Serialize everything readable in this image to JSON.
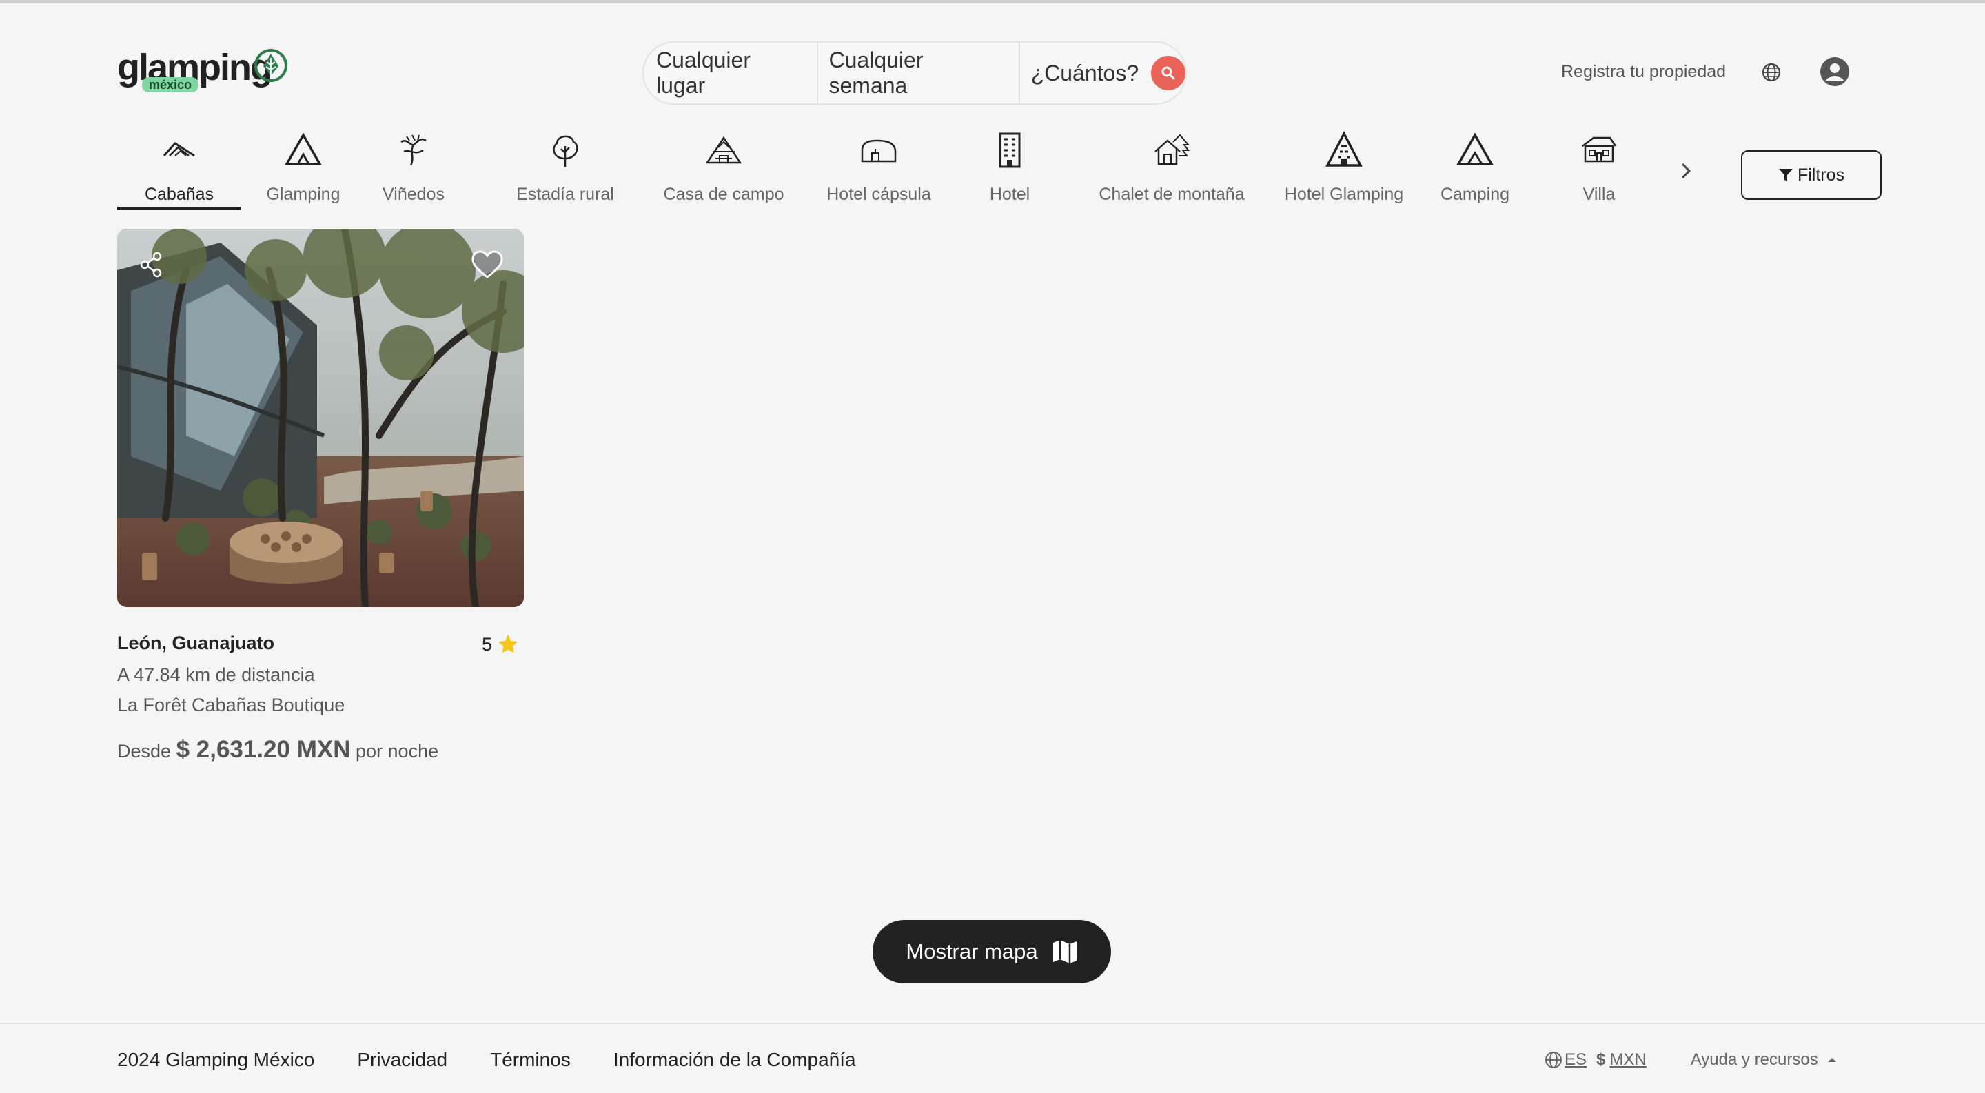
{
  "header": {
    "logo_text": "glamping",
    "logo_sub": "méxico",
    "search": {
      "location": "Cualquier lugar",
      "week": "Cualquier semana",
      "guests": "¿Cuántos?"
    },
    "register": "Registra tu propiedad"
  },
  "categories": [
    {
      "label": "Cabañas",
      "icon": "cabin-icon",
      "active": true
    },
    {
      "label": "Glamping",
      "icon": "tent-icon"
    },
    {
      "label": "Viñedos",
      "icon": "vineyard-icon"
    },
    {
      "label": "Estadía rural",
      "icon": "tree-icon"
    },
    {
      "label": "Casa de campo",
      "icon": "countryhouse-icon"
    },
    {
      "label": "Hotel cápsula",
      "icon": "capsule-icon"
    },
    {
      "label": "Hotel",
      "icon": "building-icon"
    },
    {
      "label": "Chalet de montaña",
      "icon": "chalet-icon"
    },
    {
      "label": "Hotel Glamping",
      "icon": "hotel-tent-icon"
    },
    {
      "label": "Camping",
      "icon": "camping-icon"
    },
    {
      "label": "Villa",
      "icon": "villa-icon"
    }
  ],
  "filters_label": "Filtros",
  "listing": {
    "location": "León, Guanajuato",
    "rating": "5",
    "distance": "A 47.84 km de distancia",
    "name": "La Forêt Cabañas Boutique",
    "price_prefix": "Desde",
    "price": "$ 2,631.20 MXN",
    "price_suffix": "por noche"
  },
  "map_button": "Mostrar mapa",
  "footer": {
    "copyright": "2024 Glamping México",
    "privacy": "Privacidad",
    "terms": "Términos",
    "company": "Información de la Compañía",
    "lang": "ES",
    "currency": "MXN",
    "help": "Ayuda y recursos"
  },
  "colors": {
    "accent": "#ea6358",
    "brand_green": "#2e7d4f",
    "dark": "#222222",
    "star": "#f5c518"
  }
}
